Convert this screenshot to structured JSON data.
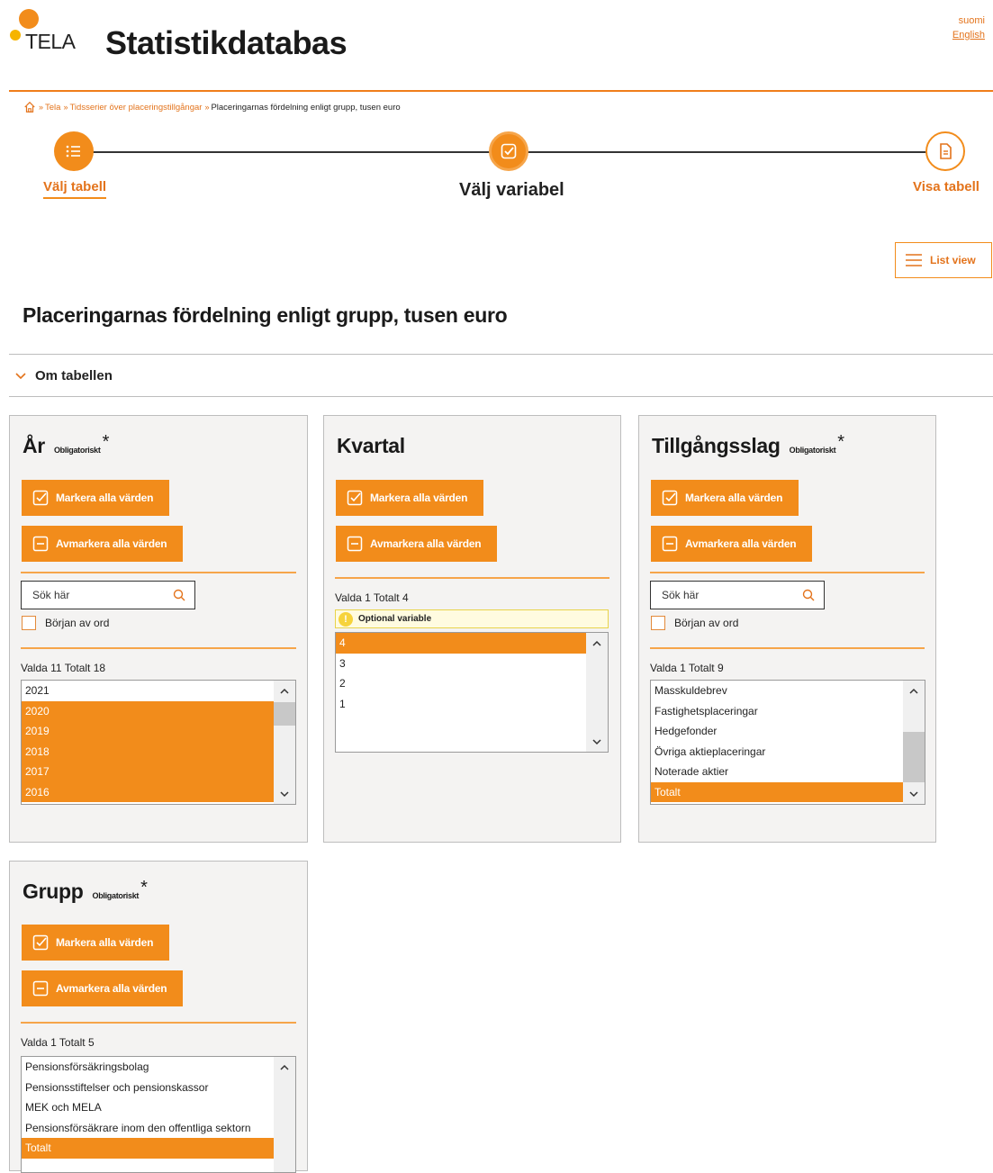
{
  "header": {
    "logo_text": "TELA",
    "site_title": "Statistikdatabas",
    "lang_suomi": "suomi",
    "lang_english": "English"
  },
  "breadcrumb": {
    "items": [
      "Tela",
      "Tidsserier över placeringstillgångar"
    ],
    "current": "Placeringarnas fördelning enligt grupp, tusen euro",
    "separator": "»"
  },
  "stepper": {
    "step1": "Välj tabell",
    "step2": "Välj variabel",
    "step3": "Visa tabell"
  },
  "list_view_label": "List view",
  "page_title": "Placeringarnas fördelning enligt grupp, tusen euro",
  "om_tabellen": "Om tabellen",
  "common": {
    "select_all": "Markera alla värden",
    "deselect_all": "Avmarkera alla värden",
    "search_placeholder": "Sök här",
    "word_start": "Början av ord",
    "required": "Obligatoriskt",
    "required_star": "*",
    "optional_variable": "Optional variable"
  },
  "panels": {
    "ar": {
      "title": "År",
      "count": "Valda 11 Totalt 18",
      "options": [
        "2021",
        "2020",
        "2019",
        "2018",
        "2017",
        "2016"
      ],
      "selected": [
        false,
        true,
        true,
        true,
        true,
        true
      ]
    },
    "kvartal": {
      "title": "Kvartal",
      "count": "Valda 1 Totalt 4",
      "options": [
        "4",
        "3",
        "2",
        "1"
      ],
      "selected": [
        true,
        false,
        false,
        false
      ]
    },
    "tillgangsslag": {
      "title": "Tillgångsslag",
      "count": "Valda 1 Totalt 9",
      "options": [
        "Masskuldebrev",
        "Fastighetsplaceringar",
        "Hedgefonder",
        "Övriga aktieplaceringar",
        "Noterade aktier",
        "Totalt"
      ],
      "selected": [
        false,
        false,
        false,
        false,
        false,
        true
      ]
    },
    "grupp": {
      "title": "Grupp",
      "count": "Valda 1 Totalt 5",
      "options": [
        "Pensionsförsäkringsbolag",
        "Pensionsstiftelser och pensionskassor",
        "MEK och MELA",
        "Pensionsförsäkrare inom den offentliga sektorn",
        "Totalt"
      ],
      "selected": [
        false,
        false,
        false,
        false,
        true
      ]
    }
  },
  "colors": {
    "accent": "#f28c1b",
    "accent_text": "#e3731b",
    "panel_bg": "#f4f3f2"
  },
  "icons": {
    "home": "home-icon",
    "step1": "list-icon",
    "step2": "check-icon",
    "step3": "document-icon",
    "list_view": "hamburger-icon",
    "search": "search-icon",
    "select_all": "checkbox-check-icon",
    "deselect_all": "checkbox-minus-icon",
    "warning": "info-icon"
  }
}
